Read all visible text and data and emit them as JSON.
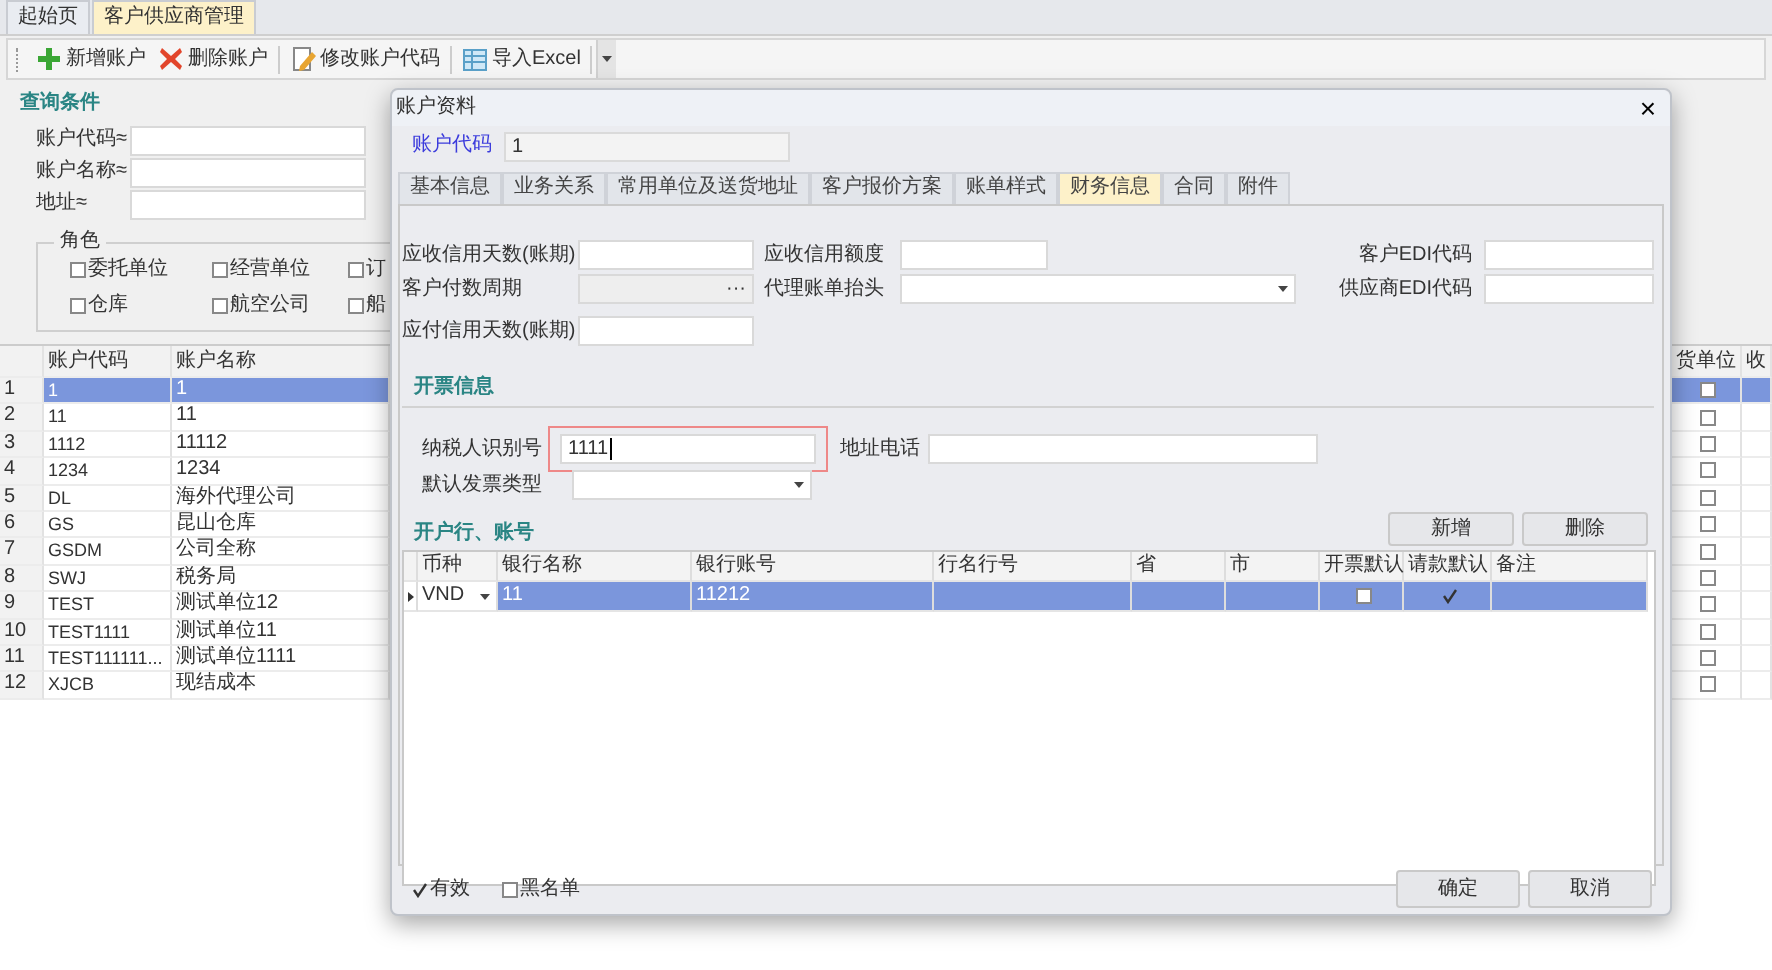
{
  "tabs": [
    {
      "label": "起始页",
      "selected": false
    },
    {
      "label": "客户供应商管理",
      "selected": true
    }
  ],
  "toolbar": [
    {
      "kind": "add",
      "label": "新增账户"
    },
    {
      "kind": "delete",
      "label": "删除账户"
    },
    {
      "kind": "edit",
      "label": "修改账户代码"
    },
    {
      "kind": "excel",
      "label": "导入Excel"
    }
  ],
  "query": {
    "title": "查询条件",
    "fields": [
      {
        "label": "账户代码≈"
      },
      {
        "label": "账户名称≈"
      },
      {
        "label": "地址≈"
      }
    ],
    "roles": {
      "title": "角色",
      "options": [
        {
          "label": "委托单位",
          "checked": false
        },
        {
          "label": "经营单位",
          "checked": false
        },
        {
          "label": "订",
          "checked": false
        },
        {
          "label": "仓库",
          "checked": false
        },
        {
          "label": "航空公司",
          "checked": false
        },
        {
          "label": "船",
          "checked": false
        }
      ]
    }
  },
  "grid": {
    "columns": [
      "账户代码",
      "账户名称",
      "货单位",
      "收"
    ],
    "rows": [
      {
        "num": "1",
        "code": "1",
        "name": "1",
        "selected": true,
        "flag": false
      },
      {
        "num": "2",
        "code": "11",
        "name": "11",
        "selected": false,
        "flag": false
      },
      {
        "num": "3",
        "code": "1112",
        "name": "11112",
        "selected": false,
        "flag": false
      },
      {
        "num": "4",
        "code": "1234",
        "name": "1234",
        "selected": false,
        "flag": false
      },
      {
        "num": "5",
        "code": "DL",
        "name": "海外代理公司",
        "selected": false,
        "flag": false
      },
      {
        "num": "6",
        "code": "GS",
        "name": "昆山仓库",
        "selected": false,
        "flag": false
      },
      {
        "num": "7",
        "code": "GSDM",
        "name": "公司全称",
        "selected": false,
        "flag": false
      },
      {
        "num": "8",
        "code": "SWJ",
        "name": "税务局",
        "selected": false,
        "flag": false
      },
      {
        "num": "9",
        "code": "TEST",
        "name": "测试单位12",
        "selected": false,
        "flag": false
      },
      {
        "num": "10",
        "code": "TEST1111",
        "name": "测试单位11",
        "selected": false,
        "flag": false
      },
      {
        "num": "11",
        "code": "TEST111111...",
        "name": "测试单位1111",
        "selected": false,
        "flag": false
      },
      {
        "num": "12",
        "code": "XJCB",
        "name": "现结成本",
        "selected": false,
        "flag": false
      }
    ]
  },
  "dialog": {
    "title": "账户资料",
    "close": "×",
    "code_label": "账户代码",
    "code_value": "1",
    "tabs": [
      {
        "label": "基本信息",
        "selected": false
      },
      {
        "label": "业务关系",
        "selected": false
      },
      {
        "label": "常用单位及送货地址",
        "selected": false
      },
      {
        "label": "客户报价方案",
        "selected": false
      },
      {
        "label": "账单样式",
        "selected": false
      },
      {
        "label": "财务信息",
        "selected": true
      },
      {
        "label": "合同",
        "selected": false
      },
      {
        "label": "附件",
        "selected": false
      }
    ],
    "finance_rows": [
      [
        {
          "label": "应收信用天数(账期)",
          "kind": "text"
        },
        {
          "label": "应收信用额度",
          "kind": "text"
        },
        {
          "label": "客户EDI代码",
          "kind": "text"
        }
      ],
      [
        {
          "label": "客户付数周期",
          "kind": "lookup",
          "button": "···",
          "disabled": true
        },
        {
          "label": "代理账单抬头",
          "kind": "dropdown"
        },
        {
          "label": "供应商EDI代码",
          "kind": "text"
        }
      ],
      [
        {
          "label": "应付信用天数(账期)",
          "kind": "text"
        }
      ]
    ],
    "invoice": {
      "title": "开票信息",
      "rows": [
        [
          {
            "label": "纳税人识别号",
            "kind": "text",
            "value": "1111",
            "focused": true
          },
          {
            "label": "地址电话",
            "kind": "text",
            "focused": false
          }
        ],
        [
          {
            "label": "默认发票类型",
            "kind": "dropdown",
            "focused": false
          }
        ]
      ]
    },
    "bank": {
      "title": "开户行、账号",
      "buttons": [
        "新增",
        "删除"
      ],
      "columns": [
        "币种",
        "银行名称",
        "银行账号",
        "行名行号",
        "省",
        "市",
        "开票默认",
        "请款默认",
        "备注"
      ],
      "rows": [
        {
          "currency": "VND",
          "bank_name": "11",
          "account": "11212",
          "selected": true,
          "invoice_default": false,
          "payment_default": true
        }
      ]
    },
    "checks": [
      {
        "label": "有效",
        "checked": true
      },
      {
        "label": "黑名单",
        "checked": false
      }
    ],
    "buttons": [
      "确定",
      "取消"
    ]
  }
}
